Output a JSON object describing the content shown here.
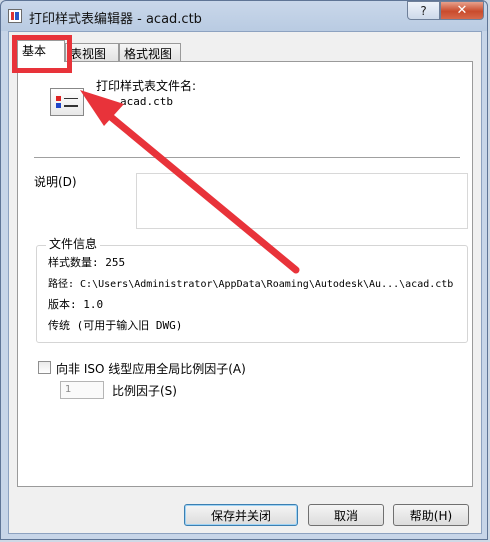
{
  "window": {
    "title": "打印样式表编辑器 - acad.ctb",
    "help_label": "?",
    "close_label": "✕"
  },
  "tabs": [
    {
      "label": "基本",
      "active": true
    },
    {
      "label": "表视图",
      "active": false
    },
    {
      "label": "格式视图",
      "active": false
    }
  ],
  "general": {
    "filename_label": "打印样式表文件名:",
    "filename_value": "acad.ctb",
    "description_label": "说明(D)",
    "description_value": ""
  },
  "file_info": {
    "group_title": "文件信息",
    "style_count": "样式数量: 255",
    "path": "路径: C:\\Users\\Administrator\\AppData\\Roaming\\Autodesk\\Au...\\acad.ctb",
    "version": "版本: 1.0",
    "legacy": "传统 (可用于输入旧 DWG)"
  },
  "options": {
    "apply_scale_label": "向非 ISO 线型应用全局比例因子(A)",
    "apply_scale_checked": false,
    "scale_value": "1",
    "scale_label": "比例因子(S)"
  },
  "buttons": {
    "save_close": "保存并关闭",
    "cancel": "取消",
    "help": "帮助(H)"
  },
  "annotation": {
    "color": "#e8333a"
  }
}
